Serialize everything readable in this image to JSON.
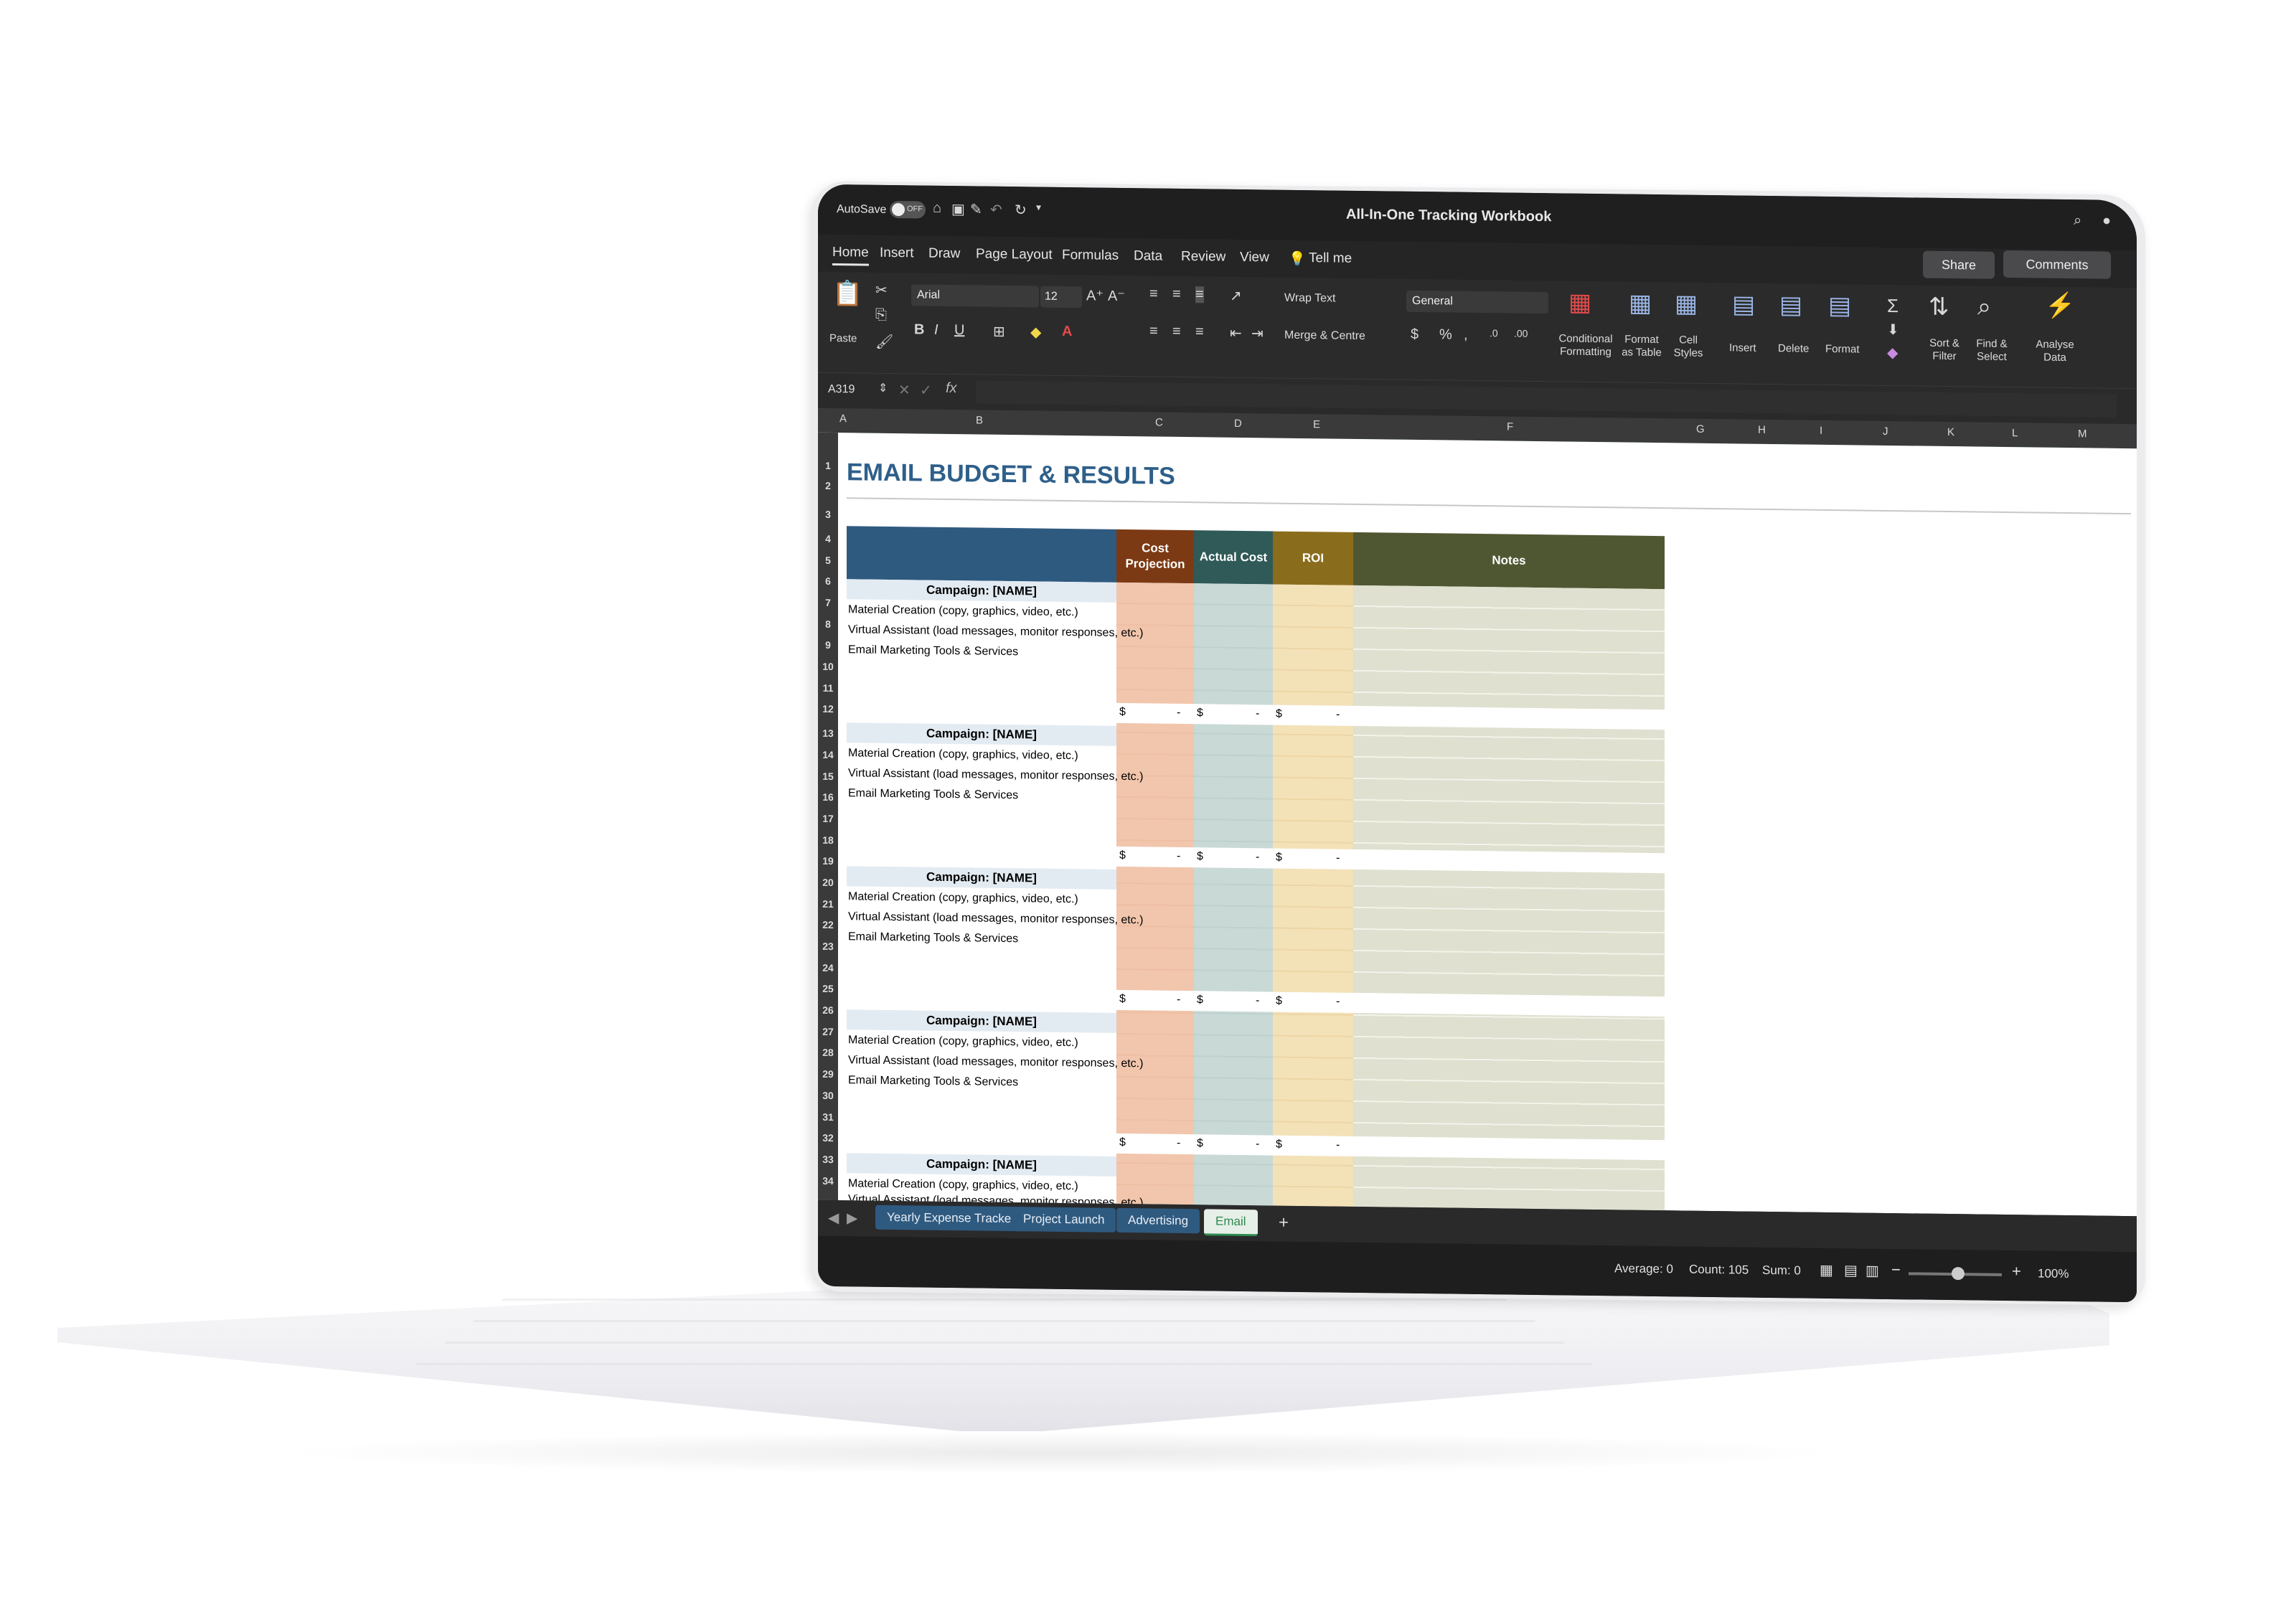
{
  "window": {
    "title": "All-In-One Tracking Workbook",
    "autosave_label": "AutoSave",
    "autosave_state": "OFF",
    "share_label": "Share",
    "comments_label": "Comments"
  },
  "ribbon_tabs": [
    "Home",
    "Insert",
    "Draw",
    "Page Layout",
    "Formulas",
    "Data",
    "Review",
    "View"
  ],
  "tell_me": "Tell me",
  "ribbon": {
    "paste": "Paste",
    "font": "Arial",
    "font_size": "12",
    "bold": "B",
    "italic": "I",
    "underline": "U",
    "wrap_text": "Wrap Text",
    "merge_centre": "Merge & Centre",
    "number_format": "General",
    "conditional_formatting": "Conditional Formatting",
    "format_as_table": "Format as Table",
    "cell_styles": "Cell Styles",
    "insert": "Insert",
    "delete": "Delete",
    "format": "Format",
    "sort_filter": "Sort & Filter",
    "find_select": "Find & Select",
    "analyse_data": "Analyse Data"
  },
  "formula_bar": {
    "name_box": "A319",
    "fx": "fx",
    "value": ""
  },
  "columns": [
    "A",
    "B",
    "C",
    "D",
    "E",
    "F",
    "G",
    "H",
    "I",
    "J",
    "K",
    "L",
    "M"
  ],
  "row_numbers": [
    "1",
    "2",
    "3",
    "4",
    "5",
    "6",
    "7",
    "8",
    "9",
    "10",
    "11",
    "12",
    "13",
    "14",
    "15",
    "16",
    "17",
    "18",
    "19",
    "20",
    "21",
    "22",
    "23",
    "24",
    "25",
    "26",
    "27",
    "28",
    "29",
    "30",
    "31",
    "32",
    "33",
    "34"
  ],
  "sheet": {
    "title": "EMAIL BUDGET & RESULTS",
    "headers": {
      "cost_projection": "Cost Projection",
      "actual_cost": "Actual Cost",
      "roi": "ROI",
      "notes": "Notes"
    },
    "campaign_label": "Campaign: [NAME]",
    "items": [
      "Material Creation (copy, graphics, video, etc.)",
      "Virtual Assistant (load messages, monitor responses, etc.)",
      "Email Marketing Tools & Services"
    ],
    "currency": "$",
    "dash": "-"
  },
  "sheet_tabs": [
    "Yearly Expense Tracker",
    "Project Launch",
    "Advertising",
    "Email"
  ],
  "active_sheet_tab": "Email",
  "add_sheet": "+",
  "status": {
    "average": "Average: 0",
    "count": "Count: 105",
    "sum": "Sum: 0",
    "zoom": "100%"
  },
  "colors": {
    "header_blue": "#2f5a80",
    "cost_projection": "#7c3a14",
    "actual_cost": "#2f5a57",
    "roi": "#8a6d1c",
    "notes": "#4f5732",
    "accent_green": "#2d8a4e"
  }
}
